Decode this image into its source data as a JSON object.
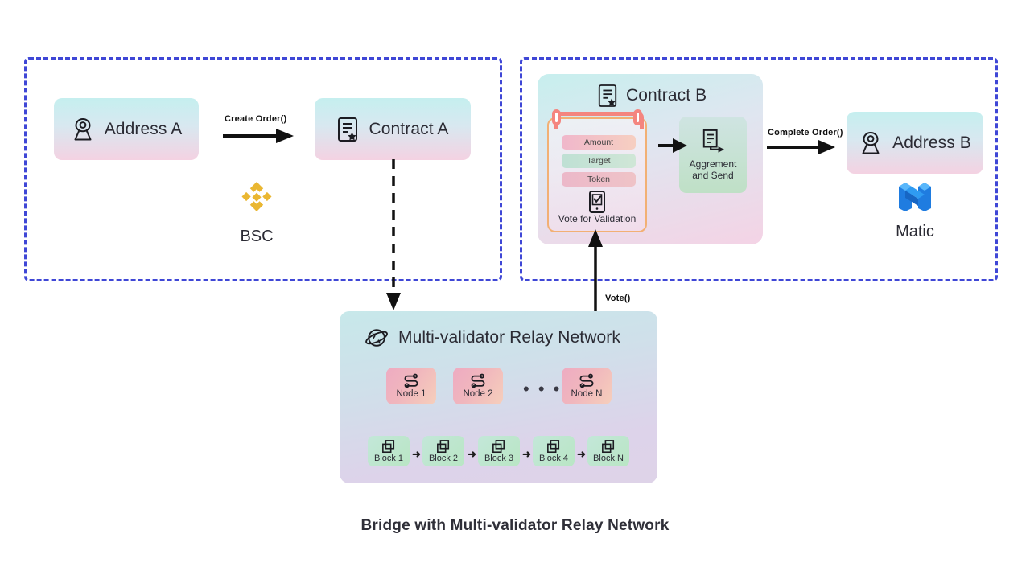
{
  "caption": "Bridge with Multi-validator Relay Network",
  "colors": {
    "panel_border": "#3f47d6",
    "clipboard_clip": "#f4857f",
    "clipboard_frame": "#f2b074",
    "bsc_gold": "#eab732",
    "matic_blue": "#2f8ef4",
    "arrow_black": "#111111"
  },
  "panels": {
    "left": {
      "name": "BSC chain panel"
    },
    "right": {
      "name": "Matic chain panel"
    }
  },
  "left_panel": {
    "address_a": {
      "label": "Address A",
      "icon": "address-pin-icon"
    },
    "contract_a": {
      "label": "Contract A",
      "icon": "contract-document-icon"
    },
    "arrow_create_order": {
      "label": "Create Order()"
    },
    "chain": {
      "name": "BSC",
      "icon": "binance-logo-icon"
    }
  },
  "right_panel": {
    "contract_b": {
      "title": "Contract B",
      "icon": "contract-document-icon",
      "clipboard": {
        "pills": [
          {
            "label": "Amount"
          },
          {
            "label": "Target"
          },
          {
            "label": "Token"
          }
        ],
        "vote_icon": "phone-check-icon",
        "vote_label": "Vote for Validation"
      },
      "aggrement": {
        "icon": "document-send-icon",
        "line1": "Aggrement",
        "line2": "and Send"
      }
    },
    "address_b": {
      "label": "Address B",
      "icon": "address-pin-icon"
    },
    "arrow_complete_order": {
      "label": "Complete Order()"
    },
    "chain": {
      "name": "Matic",
      "icon": "matic-logo-icon"
    }
  },
  "relay": {
    "title": "Multi-validator Relay Network",
    "icon": "globe-network-icon",
    "nodes": [
      {
        "label": "Node 1",
        "icon": "node-link-icon"
      },
      {
        "label": "Node 2",
        "icon": "node-link-icon"
      },
      {
        "label": "Node N",
        "icon": "node-link-icon"
      }
    ],
    "nodes_ellipsis": "• • •",
    "blocks": [
      {
        "label": "Block 1",
        "icon": "stacked-blocks-icon"
      },
      {
        "label": "Block 2",
        "icon": "stacked-blocks-icon"
      },
      {
        "label": "Block 3",
        "icon": "stacked-blocks-icon"
      },
      {
        "label": "Block 4",
        "icon": "stacked-blocks-icon"
      },
      {
        "label": "Block N",
        "icon": "stacked-blocks-icon"
      }
    ],
    "block_arrow": "➜"
  },
  "arrows": {
    "vote": {
      "label": "Vote()"
    }
  }
}
